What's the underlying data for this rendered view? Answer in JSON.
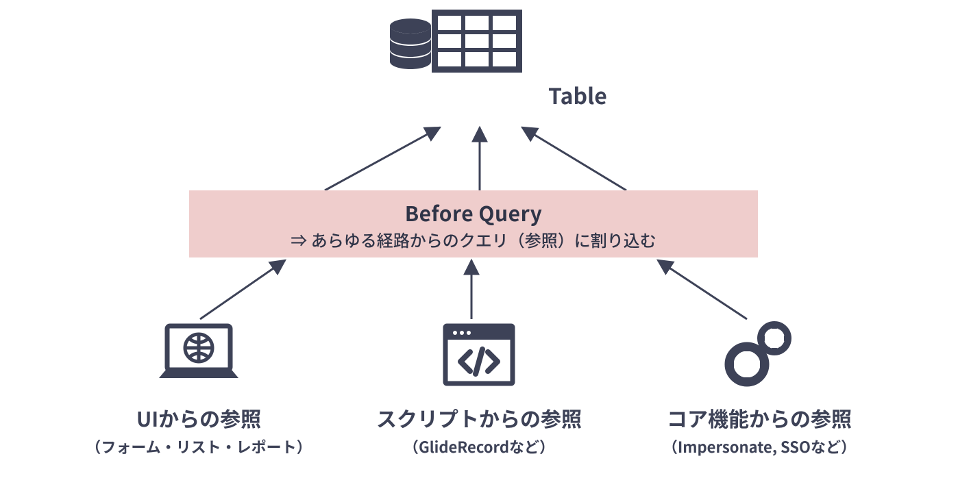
{
  "top": {
    "table_label": "Table",
    "db_icon": "database-icon",
    "table_icon": "table-grid-icon"
  },
  "band": {
    "title": "Before Query",
    "subtitle": "⇒ あらゆる経路からのクエリ（参照）に割り込む"
  },
  "nodes": [
    {
      "icon": "laptop-globe-icon",
      "title": "UIからの参照",
      "subtitle": "（フォーム・リスト・レポート）"
    },
    {
      "icon": "code-window-icon",
      "title": "スクリプトからの参照",
      "subtitle": "（GlideRecordなど）"
    },
    {
      "icon": "gears-icon",
      "title": "コア機能からの参照",
      "subtitle": "（Impersonate, SSOなど）"
    }
  ],
  "colors": {
    "ink": "#3d4257",
    "band": "#efcdcc"
  }
}
